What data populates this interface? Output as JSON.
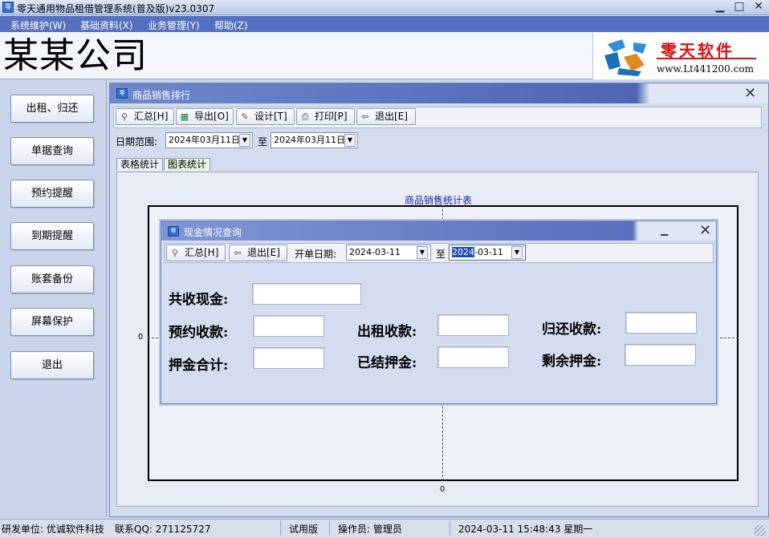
{
  "window": {
    "title": "零天通用物品租借管理系统(普及版)v23.0307",
    "minimize": "▁",
    "maximize": "□",
    "close": "✕"
  },
  "menu": [
    "系统维护(W)",
    "基础资料(X)",
    "业务管理(Y)",
    "帮助(Z)"
  ],
  "header": {
    "company": "某某公司",
    "logo_brand": "零天软件",
    "logo_url": "www.Lt441200.com"
  },
  "sidebar": [
    "出租、归还",
    "单据查询",
    "预约提醒",
    "到期提醒",
    "账套备份",
    "屏幕保护",
    "退出"
  ],
  "child_window": {
    "title": "商品销售排行",
    "close": "✕",
    "toolbar": {
      "summary": "汇总[H]",
      "export": "导出[O]",
      "design": "设计[T]",
      "print": "打印[P]",
      "exit": "退出[E]"
    },
    "date_range_label": "日期范围:",
    "date_from": "2024年03月11日",
    "date_to": "2024年03月11日",
    "to_label": "至",
    "tabs": [
      "表格统计",
      "图表统计"
    ],
    "active_tab": "图表统计"
  },
  "chart_data": {
    "type": "bar",
    "title": "商品销售统计表",
    "categories": [],
    "values": [],
    "y_tick_labels": [
      "0"
    ],
    "x_tick_labels": [
      "0"
    ]
  },
  "dialog": {
    "title": "现金情况查询",
    "minimize": "▁",
    "close": "✕",
    "summary_button": "汇总[H]",
    "exit_button": "退出[E]",
    "open_date_label": "开单日期:",
    "date_from": "2024-03-11",
    "to_label": "至",
    "date_to_selected": "2024",
    "date_to_rest": "-03-11",
    "fields": {
      "total_cash": {
        "label": "共收现金:",
        "value": ""
      },
      "reservation": {
        "label": "预约收款:",
        "value": ""
      },
      "rental": {
        "label": "出租收款:",
        "value": ""
      },
      "return": {
        "label": "归还收款:",
        "value": ""
      },
      "deposit_total": {
        "label": "押金合计:",
        "value": ""
      },
      "deposit_settled": {
        "label": "已结押金:",
        "value": ""
      },
      "deposit_remaining": {
        "label": "剩余押金:",
        "value": ""
      }
    }
  },
  "status": {
    "developer": "研发单位: 优诚软件科技",
    "qq": "联系QQ: 271125727",
    "edition": "试用版",
    "operator": "操作员: 管理员",
    "datetime": "2024-03-11 15:48:43 星期一"
  }
}
